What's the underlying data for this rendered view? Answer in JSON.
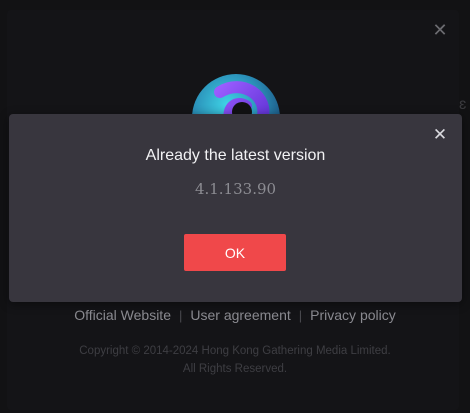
{
  "background_window": {
    "close_label": "✕",
    "footer_links": {
      "official_website": "Official Website",
      "user_agreement": "User agreement",
      "privacy_policy": "Privacy policy",
      "separator": "|"
    },
    "copyright_line1": "Copyright © 2014-2024 Hong Kong Gathering Media Limited.",
    "copyright_line2": "All Rights Reserved.",
    "logo_icon": "app-logo-icon"
  },
  "dialog": {
    "title": "Already the latest version",
    "version": "4.1.133.90",
    "ok_label": "OK",
    "close_label": "✕",
    "colors": {
      "background": "#38363e",
      "ok_button": "#f0484a"
    }
  }
}
